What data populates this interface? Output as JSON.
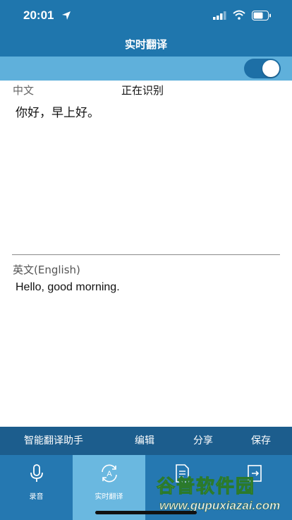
{
  "status_bar": {
    "time": "20:01"
  },
  "header": {
    "title": "实时翻译"
  },
  "toggle": {
    "on": true
  },
  "source": {
    "language_label": "中文",
    "status": "正在识别",
    "text": "你好，早上好。"
  },
  "target": {
    "language_label": "英文(English)",
    "text": "Hello, good morning."
  },
  "actions": [
    {
      "label": "智能翻译助手"
    },
    {
      "label": "编辑"
    },
    {
      "label": "分享"
    },
    {
      "label": "保存"
    }
  ],
  "tabs": [
    {
      "label": "录音",
      "icon": "microphone-icon"
    },
    {
      "label": "实时翻译",
      "icon": "translate-icon",
      "active": true
    },
    {
      "label": "",
      "icon": "document-icon"
    },
    {
      "label": "",
      "icon": "export-icon"
    }
  ],
  "watermark": {
    "title": "谷普软件园",
    "url": "www.gupuxiazai.com"
  },
  "colors": {
    "header": "#1f76ad",
    "toggle_bar": "#5fb0db",
    "action_bar": "#1c5d8d",
    "tab_bar": "#2578b1",
    "tab_active": "#6ab8e0"
  }
}
